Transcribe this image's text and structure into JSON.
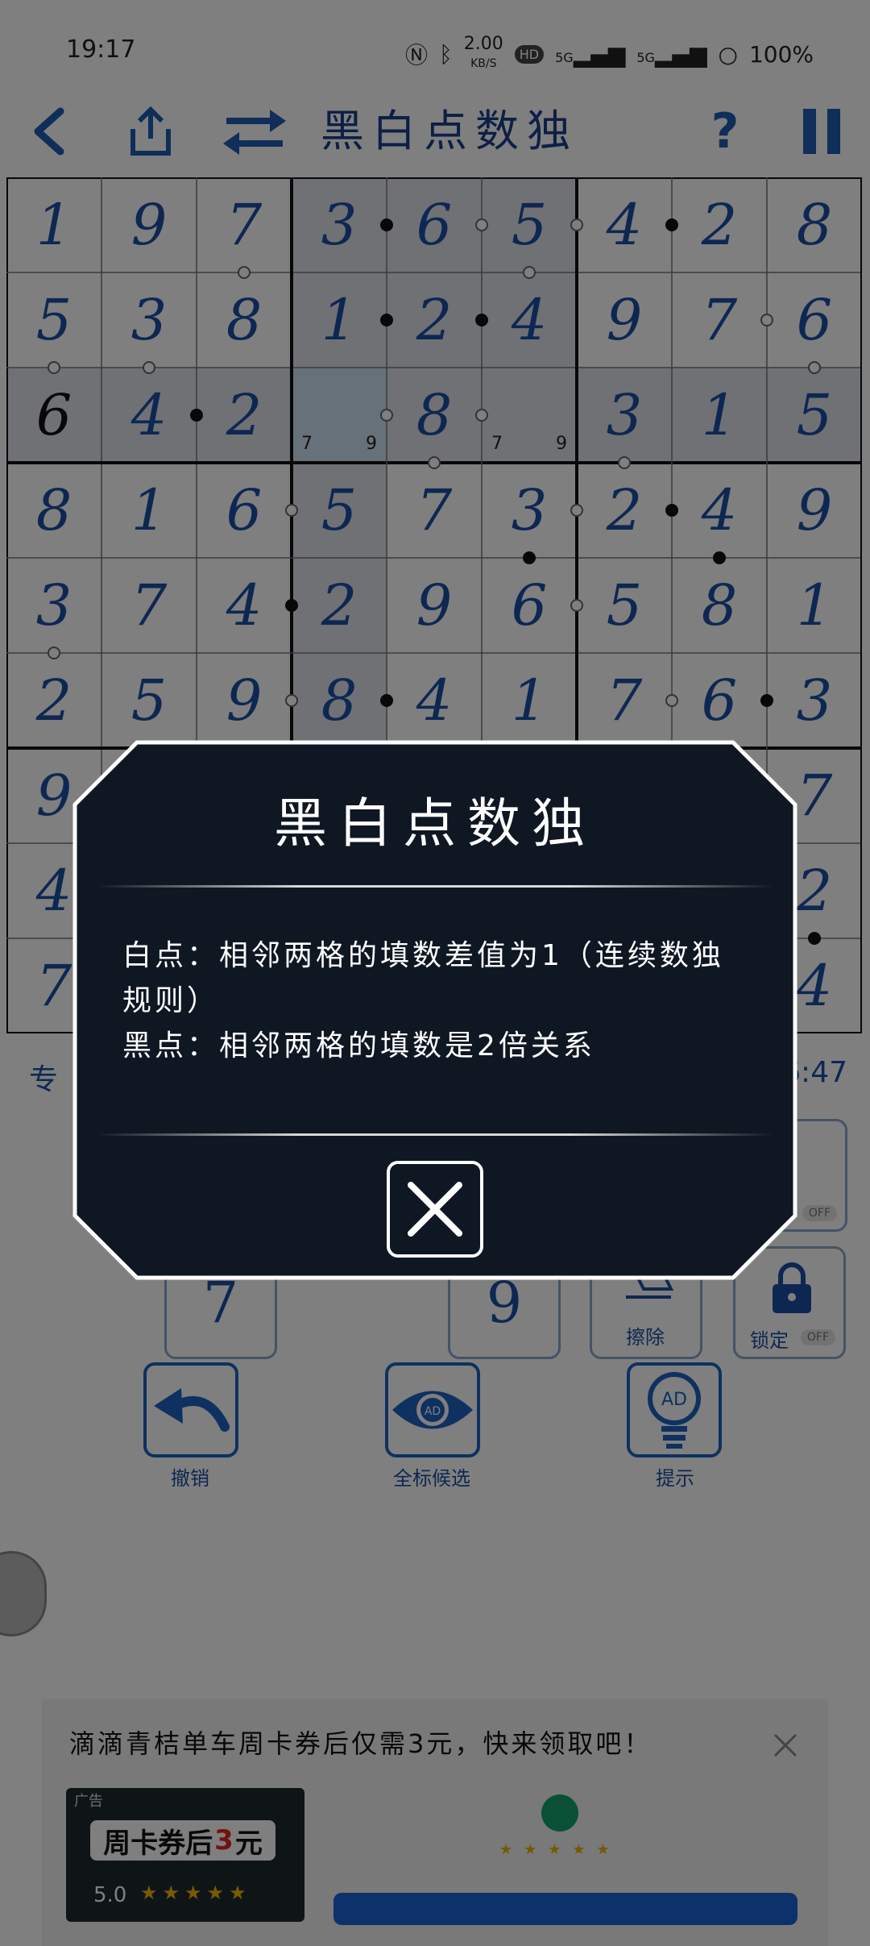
{
  "status_bar": {
    "time": "19:17",
    "net_speed_value": "2.00",
    "net_speed_unit": "KB/S",
    "hd_label": "HD",
    "signal1": "5G",
    "signal2": "5G",
    "battery": "100%"
  },
  "toolbar": {
    "title": "黑白点数独",
    "back_icon": "chevron-left-icon",
    "share_icon": "share-icon",
    "switch_icon": "swap-icon",
    "help_label": "?",
    "pause_icon": "pause-icon"
  },
  "board": {
    "grid": [
      [
        1,
        9,
        7,
        3,
        6,
        5,
        4,
        2,
        8
      ],
      [
        5,
        3,
        8,
        1,
        2,
        4,
        9,
        7,
        6
      ],
      [
        6,
        4,
        2,
        0,
        8,
        0,
        3,
        1,
        5
      ],
      [
        8,
        1,
        6,
        5,
        7,
        3,
        2,
        4,
        9
      ],
      [
        3,
        7,
        4,
        2,
        9,
        6,
        5,
        8,
        1
      ],
      [
        2,
        5,
        9,
        8,
        4,
        1,
        7,
        6,
        3
      ],
      [
        9,
        0,
        0,
        0,
        0,
        0,
        0,
        0,
        7
      ],
      [
        4,
        0,
        0,
        0,
        0,
        0,
        0,
        0,
        2
      ],
      [
        7,
        0,
        0,
        0,
        0,
        0,
        0,
        0,
        4
      ]
    ],
    "given_cells": [
      [
        2,
        0
      ]
    ],
    "candidates": [
      {
        "r": 2,
        "c": 3,
        "values": [
          "7",
          "9"
        ]
      },
      {
        "r": 2,
        "c": 5,
        "values": [
          "7",
          "9"
        ]
      }
    ]
  },
  "info": {
    "difficulty_partial": "专",
    "timer_partial": "6:47"
  },
  "keypad": {
    "visible_keys": [
      "7",
      "9"
    ],
    "partial_key": "9"
  },
  "tools": {
    "erase_label": "擦除",
    "lock_label": "锁定",
    "lock_state": "OFF",
    "note_state": "OFF"
  },
  "actions": {
    "undo_label": "撤销",
    "show_all_label": "全标候选",
    "hint_label": "提示",
    "ad_badge": "AD"
  },
  "modal": {
    "title": "黑白点数独",
    "line1": "白点：相邻两格的填数差值为1（连续数独规则）",
    "line2": "黑点：相邻两格的填数是2倍关系",
    "close_icon": "close-icon"
  },
  "ad": {
    "text": "滴滴青桔单车周卡券后仅需3元，快来领取吧！",
    "image_tag": "广告",
    "image_banner_prefix": "周卡券后",
    "image_banner_price": "3",
    "image_banner_suffix": "元",
    "image_rating": "5.0",
    "image_stars": "★★★★★",
    "close_icon": "close-icon"
  },
  "colors": {
    "accent": "#1d4ea5",
    "modal_bg": "#0f1722",
    "dim": "rgba(0,0,0,0.5)"
  }
}
